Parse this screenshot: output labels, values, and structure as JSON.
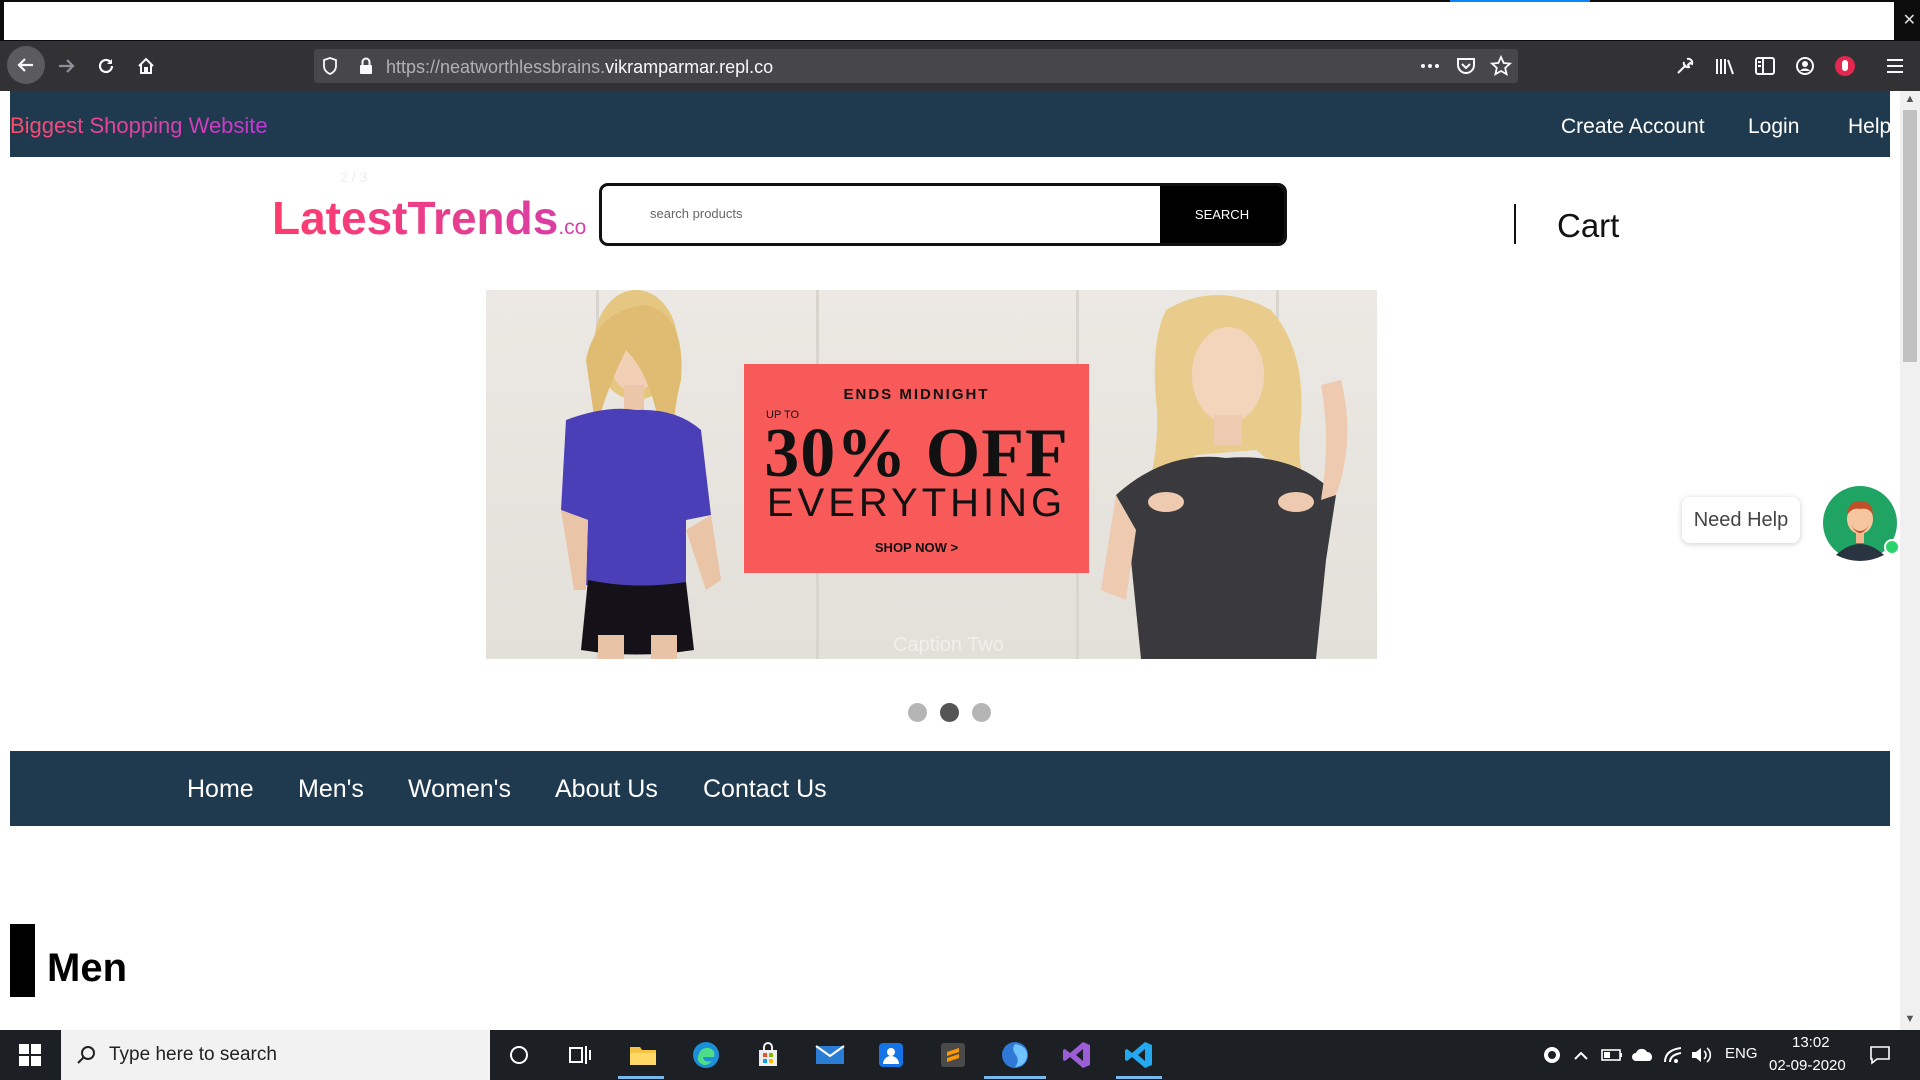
{
  "browser": {
    "url_prefix": "https://neatworthlessbrains.",
    "url_host": "vikramparmar.repl.co"
  },
  "site": {
    "topbar": {
      "brand": "Biggest Shopping Website",
      "links": [
        "Create Account",
        "Login",
        "Help"
      ]
    },
    "logo": {
      "main": "LatestTrends",
      "suffix": ".co"
    },
    "faint_counter": "2 / 3",
    "search": {
      "placeholder": "search products",
      "button": "SEARCH"
    },
    "cart_label": "Cart",
    "banner": {
      "ends": "ENDS MIDNIGHT",
      "upto": "UP TO",
      "headline": "30% OFF",
      "subline": "EVERYTHING",
      "cta": "SHOP NOW >",
      "caption": "Caption Two",
      "slides": 3,
      "active_slide": 2
    },
    "help_widget": {
      "label": "Need Help"
    },
    "main_nav": [
      "Home",
      "Men's",
      "Women's",
      "About Us",
      "Contact Us"
    ],
    "section_title": "Men"
  },
  "taskbar": {
    "search_placeholder": "Type here to search",
    "language": "ENG",
    "time": "13:02",
    "date": "02-09-2020"
  },
  "colors": {
    "nav_bg": "#1f3a4f",
    "brand_gradient_start": "#ff3b6b",
    "brand_gradient_end": "#c236d9",
    "promo_red": "#f85a5a"
  }
}
